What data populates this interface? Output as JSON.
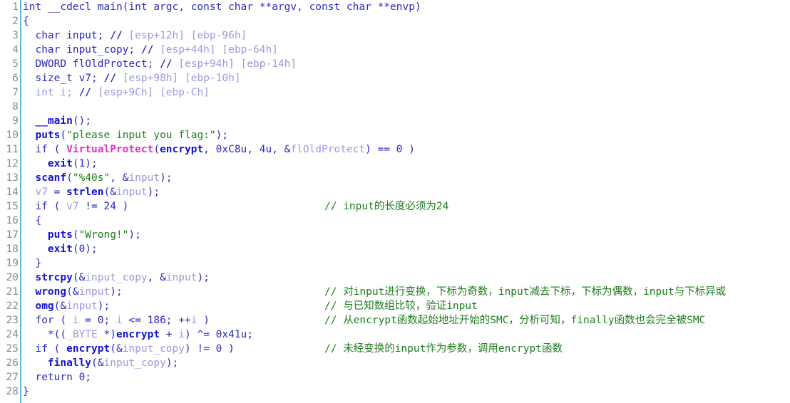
{
  "view": {
    "title": "Hex-Rays Decompiler pseudocode",
    "background_color": "#ffffff",
    "gutter_rule_color": "#5bb7d8",
    "line_count": 28
  },
  "colors": {
    "default": "#2b2bbd",
    "function": "#1313d4",
    "imported_api": "#e431c8",
    "local_variable": "#9a9ae0",
    "string_literal": "#1d7d1d",
    "comment_chinese": "#1d7d1d",
    "line_number": "#8a8a8a"
  },
  "line_numbers": [
    "1",
    "2",
    "3",
    "4",
    "5",
    "6",
    "7",
    "8",
    "9",
    "10",
    "11",
    "12",
    "13",
    "14",
    "15",
    "16",
    "17",
    "18",
    "19",
    "20",
    "21",
    "22",
    "23",
    "24",
    "25",
    "26",
    "27",
    "28"
  ],
  "code_lines": [
    "int __cdecl main(int argc, const char **argv, const char **envp)",
    "{",
    "  char input; // [esp+12h] [ebp-96h]",
    "  char input_copy; // [esp+44h] [ebp-64h]",
    "  DWORD flOldProtect; // [esp+94h] [ebp-14h]",
    "  size_t v7; // [esp+98h] [ebp-10h]",
    "  int i; // [esp+9Ch] [ebp-Ch]",
    "",
    "  __main();",
    "  puts(\"please input you flag:\");",
    "  if ( VirtualProtect(encrypt, 0xC8u, 4u, &flOldProtect) == 0 )",
    "    exit(1);",
    "  scanf(\"%40s\", &input);",
    "  v7 = strlen(&input);",
    "  if ( v7 != 24 )",
    "  {",
    "    puts(\"Wrong!\");",
    "    exit(0);",
    "  }",
    "  strcpy(&input_copy, &input);",
    "  wrong(&input);",
    "  omg(&input);",
    "  for ( i = 0; i <= 186; ++i )",
    "    *((_BYTE *)encrypt + i) ^= 0x41u;",
    "  if ( encrypt(&input_copy) != 0 )",
    "    finally(&input_copy);",
    "  return 0;",
    "}"
  ],
  "side_comments": {
    "line15": "// input的长度必须为24",
    "line21": "// 对input进行变换，下标为奇数，input减去下标，下标为偶数，input与下标异或",
    "line22": "// 与已知数组比较，验证input",
    "line23": "// 从encrypt函数起始地址开始的SMC，分析可知，finally函数也会完全被SMC",
    "line25": "// 未经变换的input作为参数，调用encrypt函数"
  },
  "tokens": {
    "l1": {
      "a": "int __cdecl main(int argc, const char **argv, const char **envp)"
    },
    "l2": {
      "a": "{"
    },
    "l3": {
      "a": "  char input; ",
      "b": "// ",
      "c": "[esp+12h] [ebp-96h]"
    },
    "l4": {
      "a": "  char input_copy; ",
      "b": "// ",
      "c": "[esp+44h] [ebp-64h]"
    },
    "l5": {
      "a": "  DWORD flOldProtect; ",
      "b": "// ",
      "c": "[esp+94h] [ebp-14h]"
    },
    "l6": {
      "a": "  size_t v7; ",
      "b": "// ",
      "c": "[esp+98h] [ebp-10h]"
    },
    "l7": {
      "a": "  int i; ",
      "b": "// ",
      "c": "[esp+9Ch] [ebp-Ch]"
    },
    "l9": {
      "a": "  ",
      "b": "__main",
      "c": "();"
    },
    "l10": {
      "a": "  ",
      "b": "puts",
      "c": "(",
      "d": "\"please input you flag:\"",
      "e": ");"
    },
    "l11": {
      "a": "  if ( ",
      "b": "VirtualProtect",
      "c": "(",
      "d": "encrypt",
      "e": ", 0xC8u, 4u, &",
      "f": "flOldProtect",
      "g": ") == 0 )"
    },
    "l12": {
      "a": "    ",
      "b": "exit",
      "c": "(1);"
    },
    "l13": {
      "a": "  ",
      "b": "scanf",
      "c": "(",
      "d": "\"%40s\"",
      "e": ", &",
      "f": "input",
      "g": ");"
    },
    "l14": {
      "a": "  ",
      "b": "v7",
      "c": " = ",
      "d": "strlen",
      "e": "(&",
      "f": "input",
      "g": ");"
    },
    "l15": {
      "a": "  if ( ",
      "b": "v7",
      "c": " != 24 )"
    },
    "l16": {
      "a": "  {"
    },
    "l17": {
      "a": "    ",
      "b": "puts",
      "c": "(",
      "d": "\"Wrong!\"",
      "e": ");"
    },
    "l18": {
      "a": "    ",
      "b": "exit",
      "c": "(0);"
    },
    "l19": {
      "a": "  }"
    },
    "l20": {
      "a": "  ",
      "b": "strcpy",
      "c": "(&",
      "d": "input_copy",
      "e": ", &",
      "f": "input",
      "g": ");"
    },
    "l21": {
      "a": "  ",
      "b": "wrong",
      "c": "(&",
      "d": "input",
      "e": ");"
    },
    "l22": {
      "a": "  ",
      "b": "omg",
      "c": "(&",
      "d": "input",
      "e": ");"
    },
    "l23": {
      "a": "  for ( ",
      "b": "i",
      "c": " = 0; ",
      "d": "i",
      "e": " <= 186; ++",
      "f": "i",
      "g": " )"
    },
    "l24": {
      "a": "    *((",
      "b": "_BYTE",
      "c": " *)",
      "d": "encrypt",
      "e": " + ",
      "f": "i",
      "g": ") ^= 0x41u;"
    },
    "l25": {
      "a": "  if ( ",
      "b": "encrypt",
      "c": "(&",
      "d": "input_copy",
      "e": ") != 0 )"
    },
    "l26": {
      "a": "    ",
      "b": "finally",
      "c": "(&",
      "d": "input_copy",
      "e": ");"
    },
    "l27": {
      "a": "  return 0;"
    },
    "l28": {
      "a": "}"
    }
  }
}
